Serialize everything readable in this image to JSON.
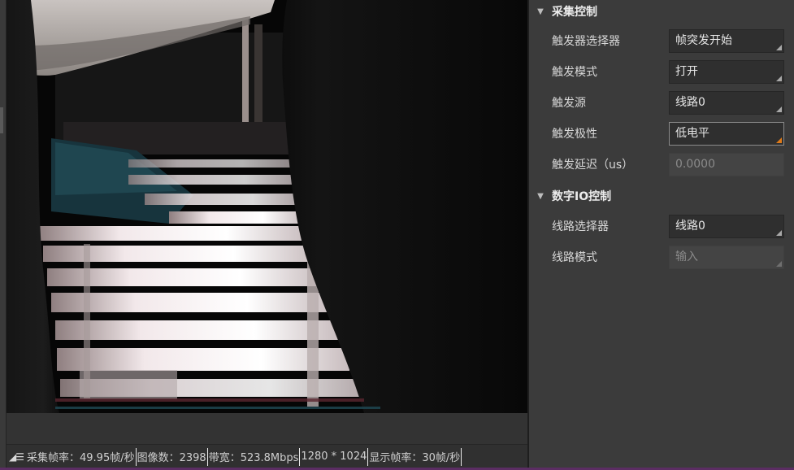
{
  "status_bar": {
    "icon": "resize-grip-and-list-icon",
    "capture_fps": "采集帧率：49.95帧/秒",
    "image_count": "图像数：2398",
    "bandwidth": "带宽：523.8Mbps",
    "resolution": "1280 * 1024",
    "display_fps": "显示帧率：30帧/秒"
  },
  "sections": [
    {
      "title": "采集控制",
      "icon": "chevron-down-icon",
      "rows": [
        {
          "label": "触发器选择器",
          "value": "帧突发开始",
          "state": "normal"
        },
        {
          "label": "触发模式",
          "value": "打开",
          "state": "normal"
        },
        {
          "label": "触发源",
          "value": "线路0",
          "state": "normal"
        },
        {
          "label": "触发极性",
          "value": "低电平",
          "state": "active"
        },
        {
          "label": "触发延迟（us）",
          "value": "0.0000",
          "state": "disabled"
        }
      ]
    },
    {
      "title": "数字IO控制",
      "icon": "chevron-down-icon",
      "rows": [
        {
          "label": "线路选择器",
          "value": "线路0",
          "state": "normal"
        },
        {
          "label": "线路模式",
          "value": "输入",
          "state": "disabled"
        }
      ]
    }
  ],
  "colors": {
    "panel_bg": "#3b3b3b",
    "field_bg": "#2f2f2f",
    "accent_orange": "#e07a18",
    "bottom_strip": "#5b2d63"
  }
}
